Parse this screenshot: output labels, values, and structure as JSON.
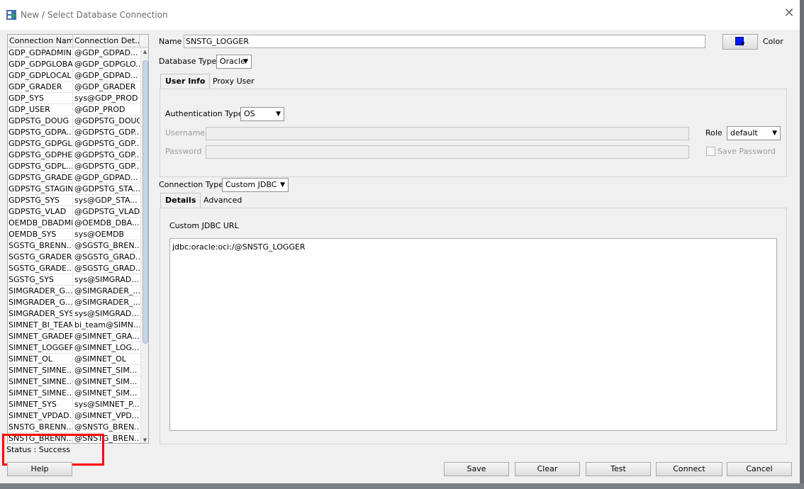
{
  "window": {
    "title": "New / Select Database Connection",
    "close": "✕"
  },
  "connections": {
    "columns": [
      "Connection Name",
      "Connection Det..."
    ],
    "rows": [
      [
        "GDP_GDPADMIN",
        "@GDP_GDPAD..."
      ],
      [
        "GDP_GDPGLOBAL",
        "@GDP_GDPGLO..."
      ],
      [
        "GDP_GDPLOCAL",
        "@GDP_GDPAD..."
      ],
      [
        "GDP_GRADER",
        "@GDP_GRADER"
      ],
      [
        "GDP_SYS",
        "sys@GDP_PROD"
      ],
      [
        "GDP_USER",
        "@GDP_PROD"
      ],
      [
        "GDPSTG_DOUG",
        "@GDPSTG_DOUG"
      ],
      [
        "GDPSTG_GDPA...",
        "@GDPSTG_GDP..."
      ],
      [
        "GDPSTG_GDPGL...",
        "@GDPSTG_GDP..."
      ],
      [
        "GDPSTG_GDPHELP",
        "@GDPSTG_GDP..."
      ],
      [
        "GDPSTG_GDPL...",
        "@GDPSTG_GDP..."
      ],
      [
        "GDPSTG_GRADER",
        "@GDP_GDPAD..."
      ],
      [
        "GDPSTG_STAGING",
        "@GDPSTG_STA..."
      ],
      [
        "GDPSTG_SYS",
        "sys@GDP_STA..."
      ],
      [
        "GDPSTG_VLAD",
        "@GDPSTG_VLAD"
      ],
      [
        "OEMDB_DBADMIN",
        "@OEMDB_DBA..."
      ],
      [
        "OEMDB_SYS",
        "sys@OEMDB"
      ],
      [
        "SGSTG_BRENN...",
        "@SGSTG_BREN..."
      ],
      [
        "SGSTG_GRADER",
        "@SGSTG_GRAD..."
      ],
      [
        "SGSTG_GRADE...",
        "@SGSTG_GRAD..."
      ],
      [
        "SGSTG_SYS",
        "sys@SIMGRAD..."
      ],
      [
        "SIMGRADER_G...",
        "@SIMGRADER_..."
      ],
      [
        "SIMGRADER_G...",
        "@SIMGRADER_..."
      ],
      [
        "SIMGRADER_SYS",
        "sys@SIMGRAD..."
      ],
      [
        "SIMNET_BI_TEAM",
        "bi_team@SIMN..."
      ],
      [
        "SIMNET_GRADER",
        "@SIMNET_GRA..."
      ],
      [
        "SIMNET_LOGGER",
        "@SIMNET_LOG..."
      ],
      [
        "SIMNET_OL",
        "@SIMNET_OL"
      ],
      [
        "SIMNET_SIMNE...",
        "@SIMNET_SIM..."
      ],
      [
        "SIMNET_SIMNE...",
        "@SIMNET_SIM..."
      ],
      [
        "SIMNET_SIMNE...",
        "@SIMNET_SIM..."
      ],
      [
        "SIMNET_SYS",
        "sys@SIMNET_P..."
      ],
      [
        "SIMNET_VPDAD...",
        "@SIMNET_VPD..."
      ],
      [
        "SNSTG_BRENN...",
        "@SNSTG_BREN..."
      ],
      [
        "SNSTG_BRENN...",
        "@SNSTG_BREN..."
      ]
    ]
  },
  "status": "Status : Success",
  "form": {
    "name_label": "Name",
    "name_value": "SNSTG_LOGGER",
    "color_label": "Color",
    "color_value": "#0018ff",
    "db_type_label": "Database Type",
    "db_type_value": "Oracle",
    "top_tabs": [
      "User Info",
      "Proxy User"
    ],
    "auth_type_label": "Authentication Type",
    "auth_type_value": "OS",
    "username_label": "Username",
    "username_value": "",
    "password_label": "Password",
    "password_value": "",
    "role_label": "Role",
    "role_value": "default",
    "save_password_label": "Save Password",
    "conn_type_label": "Connection Type",
    "conn_type_value": "Custom JDBC",
    "detail_tabs": [
      "Details",
      "Advanced"
    ],
    "jdbc_url_label": "Custom JDBC URL",
    "jdbc_url_value": "jdbc:oracle:oci:/@SNSTG_LOGGER"
  },
  "buttons": {
    "help": "Help",
    "save": "Save",
    "clear": "Clear",
    "test": "Test",
    "connect": "Connect",
    "cancel": "Cancel"
  }
}
